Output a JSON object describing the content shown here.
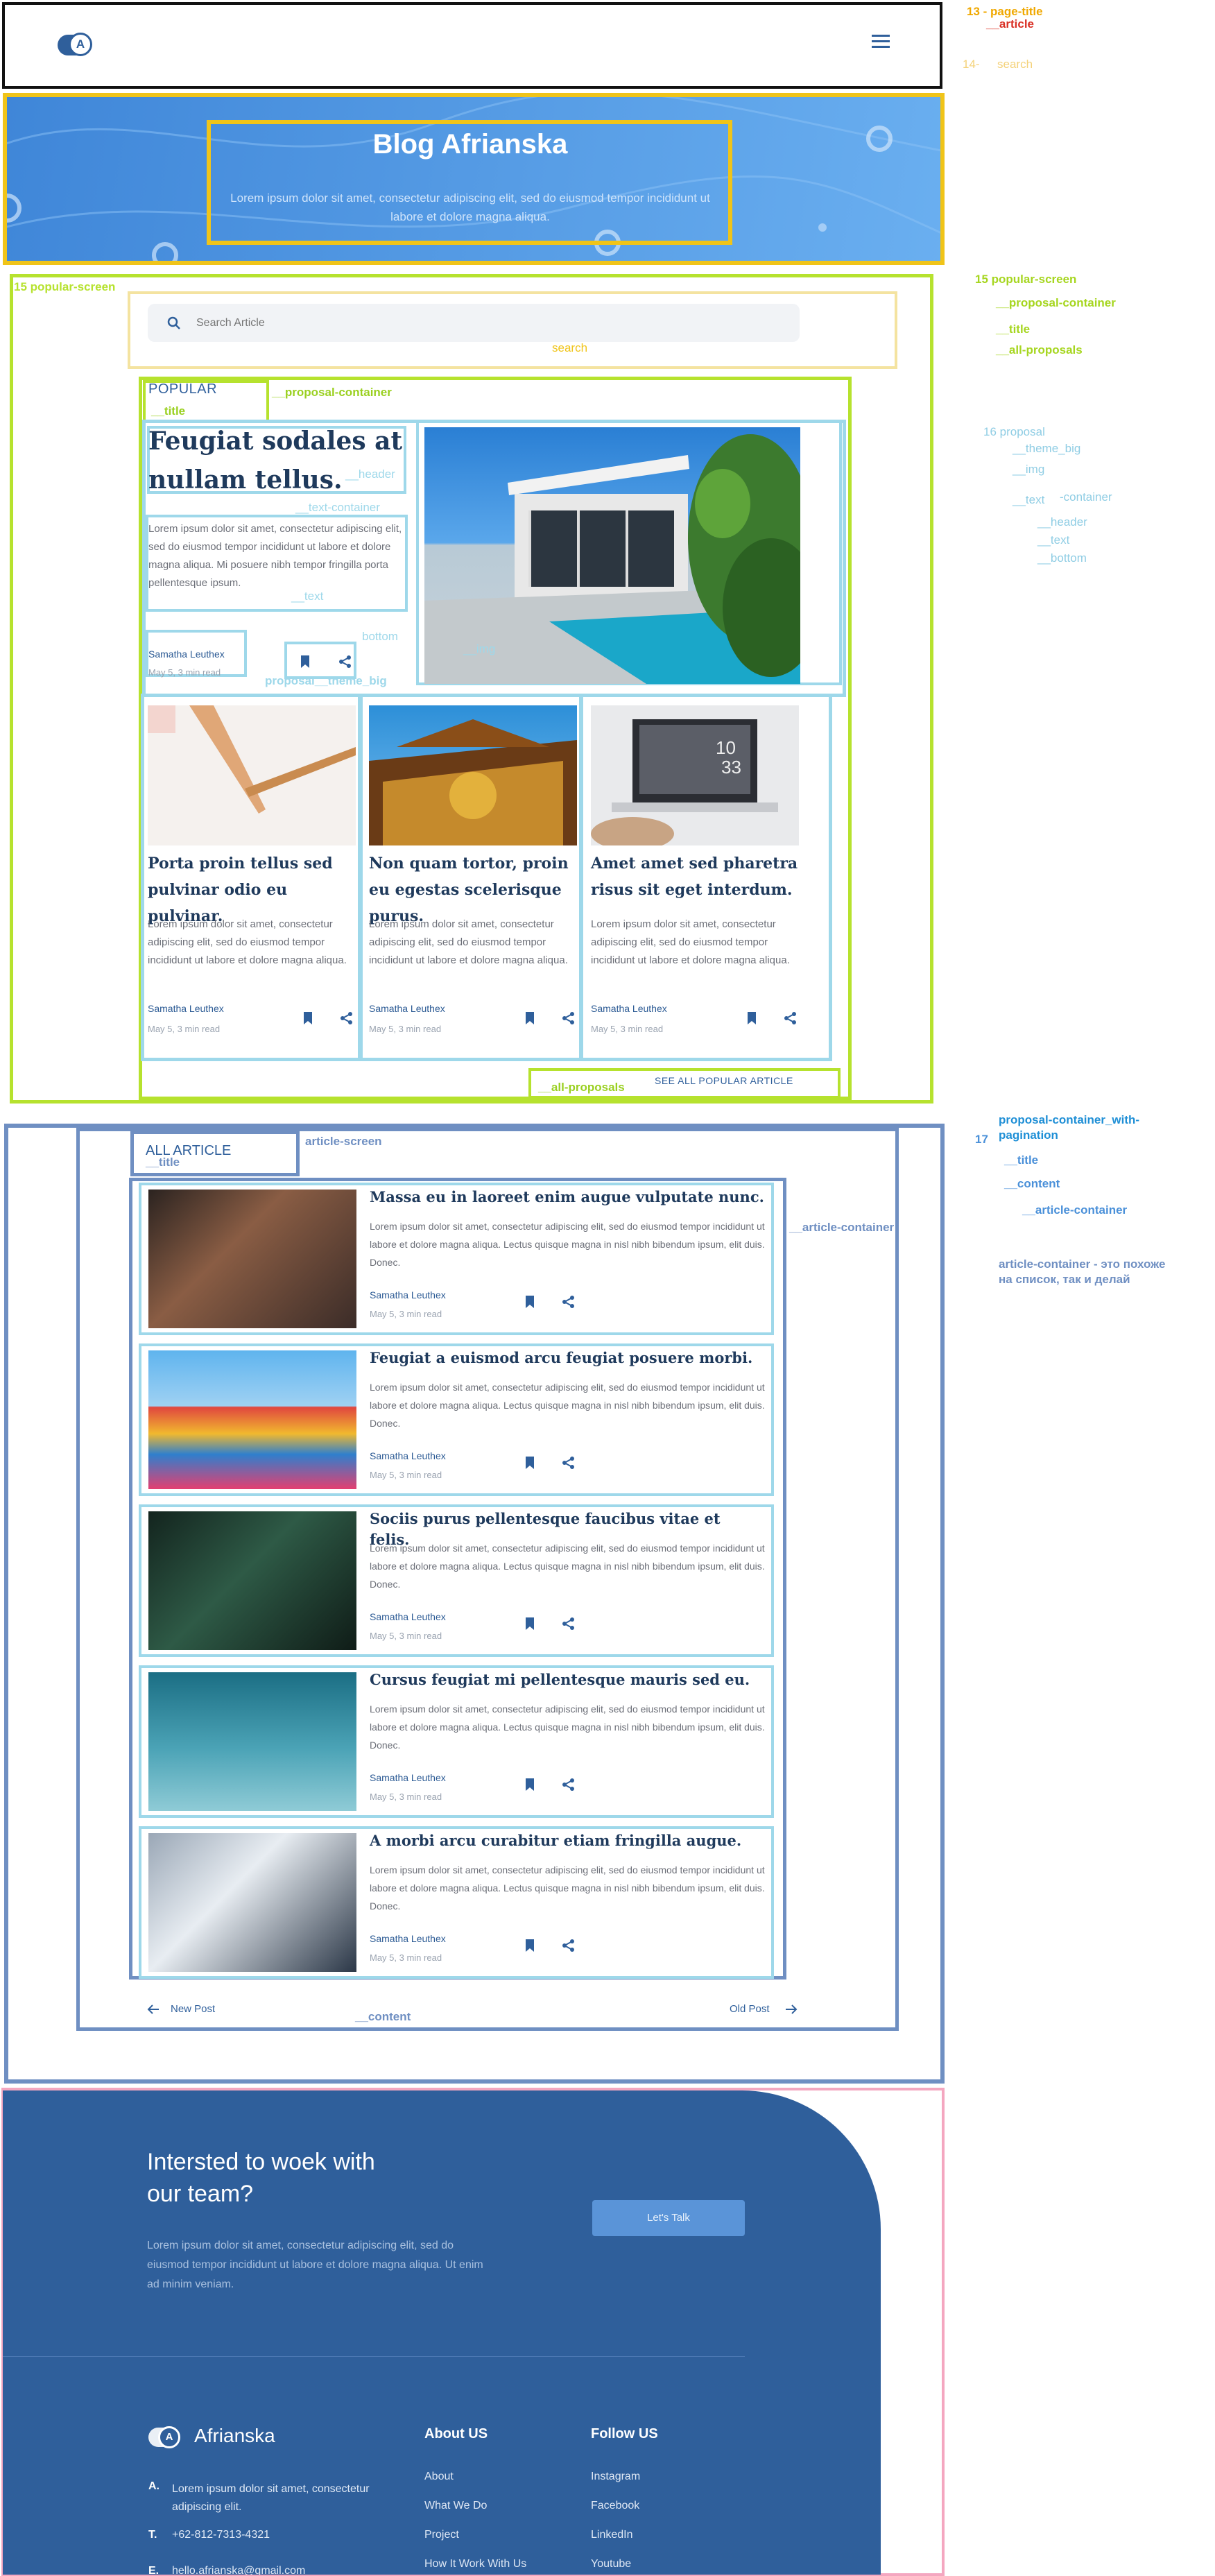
{
  "header": {
    "logo_letter": "A",
    "logo_color": "#2f5f9b"
  },
  "hero": {
    "title": "Blog Afrianska",
    "subtitle": "Lorem ipsum dolor sit amet, consectetur adipiscing elit, sed do eiusmod tempor incididunt ut labore et dolore magna aliqua."
  },
  "search": {
    "placeholder": "Search Article",
    "label": "search"
  },
  "popular": {
    "title": "POPULAR",
    "big": {
      "header": "Feugiat sodales at nullam tellus.",
      "text": "Lorem ipsum dolor sit amet, consectetur adipiscing elit, sed do eiusmod tempor incididunt ut labore et dolore magna aliqua. Mi posuere nibh tempor fringilla porta pellentesque ipsum.",
      "author": "Samatha Leuthex",
      "meta": "May 5, 3 min read"
    },
    "cards": [
      {
        "header": "Porta proin tellus sed pulvinar odio eu pulvinar.",
        "text": "Lorem ipsum dolor sit amet, consectetur adipiscing elit, sed do eiusmod tempor incididunt ut labore et dolore magna aliqua.",
        "author": "Samatha Leuthex",
        "meta": "May 5, 3 min read"
      },
      {
        "header": "Non quam tortor, proin eu egestas scelerisque purus.",
        "text": "Lorem ipsum dolor sit amet, consectetur adipiscing elit, sed do eiusmod tempor incididunt ut labore et dolore magna aliqua.",
        "author": "Samatha Leuthex",
        "meta": "May 5, 3 min read"
      },
      {
        "header": "Amet amet sed pharetra risus sit eget interdum.",
        "text": "Lorem ipsum dolor sit amet, consectetur adipiscing elit, sed do eiusmod tempor incididunt ut labore et dolore magna aliqua.",
        "author": "Samatha Leuthex",
        "meta": "May 5, 3 min read"
      }
    ],
    "see_all": "SEE ALL POPULAR ARTICLE"
  },
  "all_article": {
    "title": "ALL ARTICLE",
    "items": [
      {
        "header": "Massa eu in laoreet enim augue vulputate nunc.",
        "text": "Lorem ipsum dolor sit amet, consectetur adipiscing elit, sed do eiusmod tempor incididunt ut labore et dolore magna aliqua. Lectus quisque magna in nisl nibh bibendum ipsum, elit duis. Donec.",
        "author": "Samatha Leuthex",
        "meta": "May 5, 3 min read"
      },
      {
        "header": "Feugiat a euismod arcu feugiat posuere morbi.",
        "text": "Lorem ipsum dolor sit amet, consectetur adipiscing elit, sed do eiusmod tempor incididunt ut labore et dolore magna aliqua. Lectus quisque magna in nisl nibh bibendum ipsum, elit duis. Donec.",
        "author": "Samatha Leuthex",
        "meta": "May 5, 3 min read"
      },
      {
        "header": "Sociis purus pellentesque faucibus vitae et felis.",
        "text": "Lorem ipsum dolor sit amet, consectetur adipiscing elit, sed do eiusmod tempor incididunt ut labore et dolore magna aliqua. Lectus quisque magna in nisl nibh bibendum ipsum, elit duis. Donec.",
        "author": "Samatha Leuthex",
        "meta": "May 5, 3 min read"
      },
      {
        "header": "Cursus feugiat mi pellentesque mauris sed eu.",
        "text": "Lorem ipsum dolor sit amet, consectetur adipiscing elit, sed do eiusmod tempor incididunt ut labore et dolore magna aliqua. Lectus quisque magna in nisl nibh bibendum ipsum, elit duis. Donec.",
        "author": "Samatha Leuthex",
        "meta": "May 5, 3 min read"
      },
      {
        "header": "A morbi arcu curabitur etiam fringilla augue.",
        "text": "Lorem ipsum dolor sit amet, consectetur adipiscing elit, sed do eiusmod tempor incididunt ut labore et dolore magna aliqua. Lectus quisque magna in nisl nibh bibendum ipsum, elit duis. Donec.",
        "author": "Samatha Leuthex",
        "meta": "May 5, 3 min read"
      }
    ],
    "new_post": "New Post",
    "old_post": "Old Post"
  },
  "footer": {
    "cta_title": "Intersted to woek with our team?",
    "cta_text": "Lorem ipsum dolor sit amet, consectetur adipiscing elit, sed do eiusmod tempor incididunt ut labore et dolore magna aliqua. Ut enim ad minim veniam.",
    "cta_button": "Let's Talk",
    "brand": "Afrianska",
    "address_key": "A.",
    "address": "Lorem ipsum dolor sit amet, consectetur adipiscing elit.",
    "phone_key": "T.",
    "phone": "+62-812-7313-4321",
    "email_key": "E.",
    "email": "hello.afrianska@gmail.com",
    "about_title": "About US",
    "about_links": [
      "About",
      "What We Do",
      "Project",
      "How It Work With Us"
    ],
    "follow_title": "Follow US",
    "follow_links": [
      "Instagram",
      "Facebook",
      "LinkedIn",
      "Youtube"
    ]
  },
  "annotations": {
    "top": [
      "13 - page-title",
      "__article",
      "14-",
      "search"
    ],
    "popular_screen": [
      "15 popular-screen",
      "__proposal-container",
      "__title",
      "__all-proposals"
    ],
    "proposal": [
      "16 proposal",
      "__theme_big",
      "__img",
      "__text",
      "-container",
      "__header",
      "__text",
      "__bottom"
    ],
    "article": [
      "proposal-container_with-pagination",
      "17",
      "__title",
      "__content",
      "__article-container",
      "article-container - это похоже на список, так и делай"
    ],
    "inline": [
      "15 popular-screen",
      "search",
      "__proposal-container",
      "__title",
      "__header",
      "__text-container",
      "__text",
      "bottom",
      "__img",
      "proposal__theme_big",
      "__all-proposals",
      "article-screen",
      "__title",
      "__article-container",
      "__content"
    ]
  },
  "colors": {
    "accent": "#2f5f9b",
    "hero": "#4a92e0",
    "yellow": "#f0c419",
    "lime": "#b6e22e",
    "cyan": "#9ed8ea",
    "steel": "#6f8fc2",
    "pink": "#f4a7c0"
  }
}
